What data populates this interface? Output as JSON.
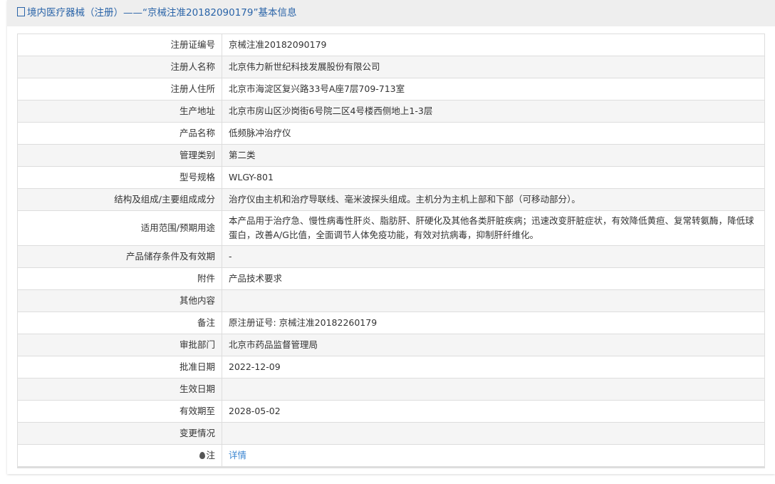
{
  "title": "境内医疗器械（注册）——“京械注准20182090179”基本信息",
  "rows": [
    {
      "label": "注册证编号",
      "value": "京械注准20182090179"
    },
    {
      "label": "注册人名称",
      "value": "北京伟力新世纪科技发展股份有限公司"
    },
    {
      "label": "注册人住所",
      "value": "北京市海淀区复兴路33号A座7层709-713室"
    },
    {
      "label": "生产地址",
      "value": "北京市房山区沙岗街6号院二区4号楼西侧地上1-3层"
    },
    {
      "label": "产品名称",
      "value": "低频脉冲治疗仪"
    },
    {
      "label": "管理类别",
      "value": "第二类"
    },
    {
      "label": "型号规格",
      "value": "WLGY-801"
    },
    {
      "label": "结构及组成/主要组成成分",
      "value": "治疗仪由主机和治疗导联线、毫米波探头组成。主机分为主机上部和下部（可移动部分）。"
    },
    {
      "label": "适用范围/预期用途",
      "value": "本产品用于治疗急、慢性病毒性肝炎、脂肪肝、肝硬化及其他各类肝脏疾病；迅速改变肝脏症状，有效降低黄疸、复常转氨酶，降低球蛋白，改善A/G比值，全面调节人体免疫功能，有效对抗病毒，抑制肝纤维化。"
    },
    {
      "label": "产品储存条件及有效期",
      "value": "-"
    },
    {
      "label": "附件",
      "value": "产品技术要求"
    },
    {
      "label": "其他内容",
      "value": ""
    },
    {
      "label": "备注",
      "value": "原注册证号: 京械注准20182260179"
    },
    {
      "label": "审批部门",
      "value": "北京市药品监督管理局"
    },
    {
      "label": "批准日期",
      "value": "2022-12-09"
    },
    {
      "label": "生效日期",
      "value": ""
    },
    {
      "label": "有效期至",
      "value": "2028-05-02"
    },
    {
      "label": "变更情况",
      "value": ""
    }
  ],
  "note": {
    "label": "注",
    "link": "详情"
  }
}
